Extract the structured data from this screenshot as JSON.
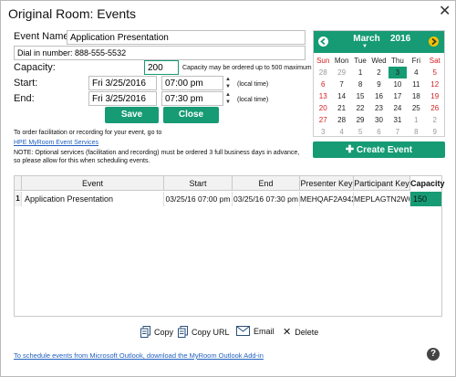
{
  "window": {
    "title": "Original Room: Events",
    "close_glyph": "✕"
  },
  "form": {
    "event_name_label": "Event Name:",
    "event_name_value": "Application Presentation",
    "dial_in_label": "Dial in number: 888-555-5532",
    "capacity_label": "Capacity:",
    "capacity_value": "200",
    "capacity_note": "Capacity may be ordered up to 500 maximum",
    "start_label": "Start:",
    "start_date": "Fri  3/25/2016",
    "start_time": "07:00 pm",
    "end_label": "End:",
    "end_date": "Fri  3/25/2016",
    "end_time": "07:30 pm",
    "local_time": "(local time)",
    "save_label": "Save",
    "close_label": "Close"
  },
  "info": {
    "order_text": "To order facilitation or recording for your event, go to",
    "services_link": "HPE MyRoom Event Services",
    "note_text": "NOTE: Optional services (facilitation and recording) must be ordered 3 full business days in advance, so please allow for this when scheduling events."
  },
  "calendar": {
    "month": "March",
    "year": "2016",
    "day_headers": [
      "Sun",
      "Mon",
      "Tue",
      "Wed",
      "Thu",
      "Fri",
      "Sat"
    ],
    "weeks": [
      [
        "28",
        "29",
        "1",
        "2",
        "3",
        "4",
        "5"
      ],
      [
        "6",
        "7",
        "8",
        "9",
        "10",
        "11",
        "12"
      ],
      [
        "13",
        "14",
        "15",
        "16",
        "17",
        "18",
        "19"
      ],
      [
        "20",
        "21",
        "22",
        "23",
        "24",
        "25",
        "26"
      ],
      [
        "27",
        "28",
        "29",
        "30",
        "31",
        "1",
        "2"
      ],
      [
        "3",
        "4",
        "5",
        "6",
        "7",
        "8",
        "9"
      ]
    ],
    "selected": "3",
    "accent_color": "#169b74"
  },
  "create_event_label": "Create Event",
  "table": {
    "headers": [
      "Event",
      "Start",
      "End",
      "Presenter Key",
      "Participant Key",
      "Capacity"
    ],
    "rows": [
      {
        "num": "1",
        "event": "Application Presentation",
        "start": "03/25/16 07:00 pm",
        "end": "03/25/16 07:30 pm",
        "presenter_key": "MEHQAF2A942",
        "participant_key": "MEPLAGTN2WC",
        "capacity": "150"
      }
    ]
  },
  "actions": {
    "copy": "Copy",
    "copy_url": "Copy URL",
    "email": "Email",
    "delete": "Delete"
  },
  "footer": {
    "outlook_link": "To schedule events from Microsoft Outlook, download the MyRoom Outlook Add-in",
    "help_glyph": "?"
  }
}
